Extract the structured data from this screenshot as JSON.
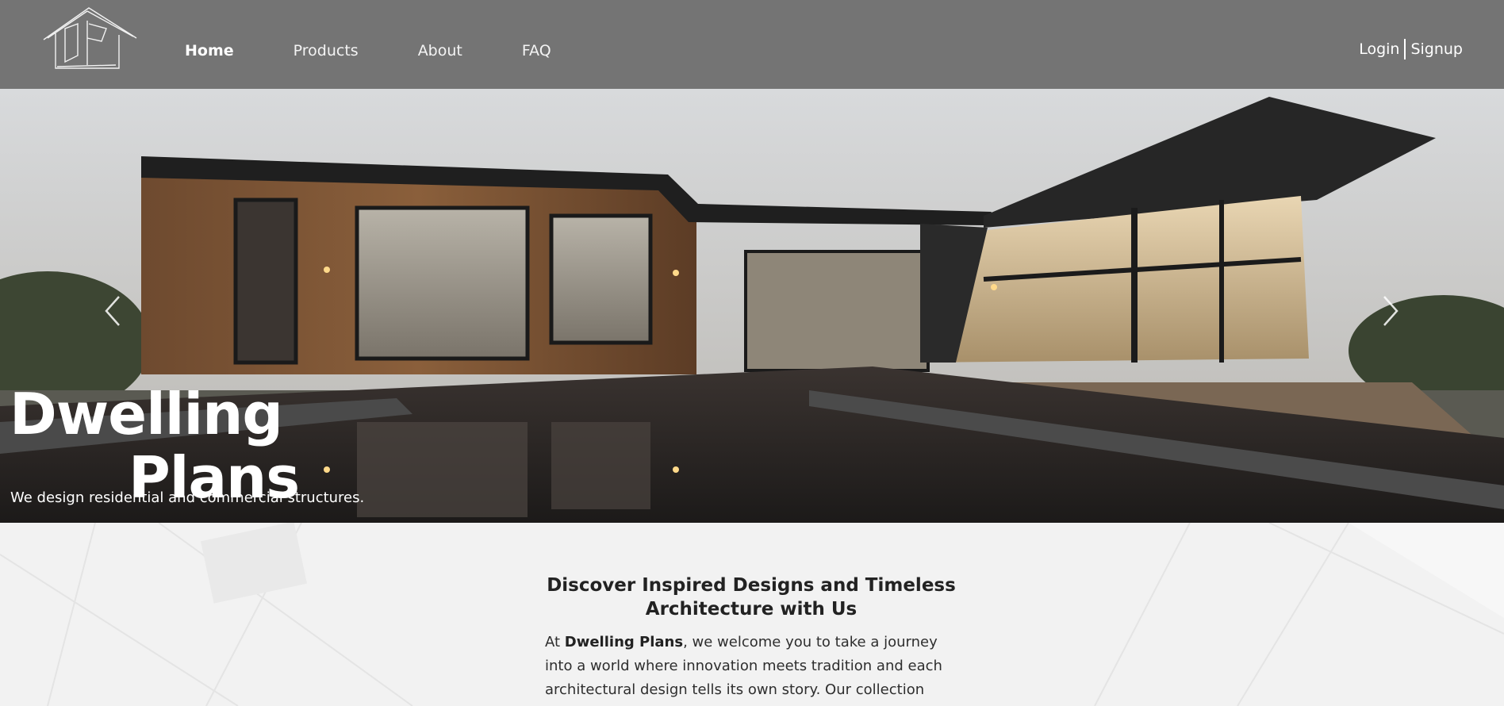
{
  "nav": {
    "logo_alt": "Dwelling Plans logo",
    "links": [
      {
        "label": "Home",
        "active": true
      },
      {
        "label": "Products",
        "active": false
      },
      {
        "label": "About",
        "active": false
      },
      {
        "label": "FAQ",
        "active": false
      }
    ],
    "login": "Login",
    "signup": "Signup",
    "background": "#747474"
  },
  "hero": {
    "title_line1": "Dwelling",
    "title_line2": "Plans",
    "subtitle": "We design residential and commercial structures.",
    "prev_icon": "chevron-left-icon",
    "next_icon": "chevron-right-icon"
  },
  "intro": {
    "heading": "Discover Inspired Designs and Timeless Architecture with Us",
    "paragraph_prefix": "At ",
    "brand": "Dwelling Plans",
    "paragraph_rest": ", we welcome you to take a journey into a world where innovation meets tradition and each architectural design tells its own story. Our collection"
  }
}
